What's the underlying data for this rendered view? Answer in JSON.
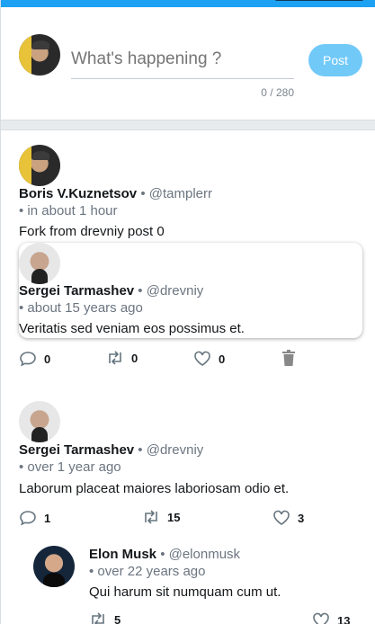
{
  "compose": {
    "placeholder": "What's happening ?",
    "counter": "0 / 280",
    "post_label": "Post"
  },
  "tweets": [
    {
      "name": "Boris V.Kuznetsov",
      "handle": "• @tamplerr",
      "time": "• in about 1 hour",
      "text": "Fork from drevniy post 0",
      "quote": {
        "name": "Sergei Tarmashev",
        "handle": "• @drevniy",
        "time": "• about 15 years ago",
        "text": "Veritatis sed veniam eos possimus et."
      },
      "replies": "0",
      "retweets": "0",
      "likes": "0"
    },
    {
      "name": "Sergei Tarmashev",
      "handle": "• @drevniy",
      "time": "• over 1 year ago",
      "text": "Laborum placeat maiores laboriosam odio et.",
      "replies": "1",
      "retweets": "15",
      "likes": "3"
    },
    {
      "name": "Elon Musk",
      "handle": "• @elonmusk",
      "time": "• over 22 years ago",
      "text": "Qui harum sit numquam cum ut.",
      "retweets": "5",
      "likes": "13"
    }
  ],
  "colors": {
    "accent": "#1da1f2",
    "post_button": "#71c9f8"
  }
}
